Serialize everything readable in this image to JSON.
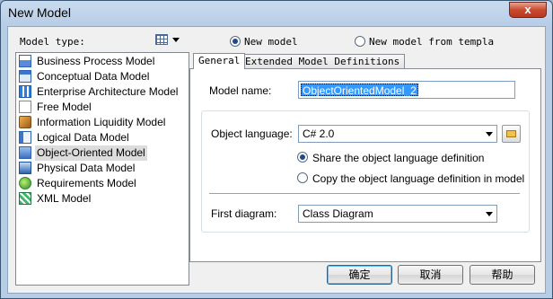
{
  "window": {
    "title": "New Model",
    "close_glyph": "x"
  },
  "left": {
    "model_type_label": "Model type:",
    "view_icon": "grid-view-icon",
    "models": [
      {
        "label": "Business Process Model",
        "icon": "bpm-icon"
      },
      {
        "label": "Conceptual Data Model",
        "icon": "cdm-icon"
      },
      {
        "label": "Enterprise Architecture Model",
        "icon": "eam-icon"
      },
      {
        "label": "Free Model",
        "icon": "free-model-icon"
      },
      {
        "label": "Information Liquidity Model",
        "icon": "ilm-icon"
      },
      {
        "label": "Logical Data Model",
        "icon": "ldm-icon"
      },
      {
        "label": "Object-Oriented Model",
        "icon": "oom-icon",
        "selected": true
      },
      {
        "label": "Physical Data Model",
        "icon": "pdm-icon"
      },
      {
        "label": "Requirements Model",
        "icon": "requirements-icon"
      },
      {
        "label": "XML Model",
        "icon": "xml-icon"
      }
    ]
  },
  "mode": {
    "new_model_label": "New model",
    "from_template_label": "New model from templa",
    "selected": "new_model"
  },
  "tabs": [
    {
      "label": "General",
      "active": true
    },
    {
      "label": "Extended Model Definitions",
      "active": false
    }
  ],
  "general": {
    "model_name_label": "Model name:",
    "model_name_value": "ObjectOrientedModel_2",
    "object_language_label": "Object language:",
    "object_language_value": "C# 2.0",
    "share_label": "Share the object language definition",
    "copy_label": "Copy the object language definition in model",
    "definition_mode": "share",
    "first_diagram_label": "First diagram:",
    "first_diagram_value": "Class Diagram"
  },
  "buttons": {
    "ok": "确定",
    "cancel": "取消",
    "help": "帮助"
  },
  "colors": {
    "selection": "#3399ff",
    "title_bar": "#b7cde6",
    "close": "#c94a2e"
  }
}
